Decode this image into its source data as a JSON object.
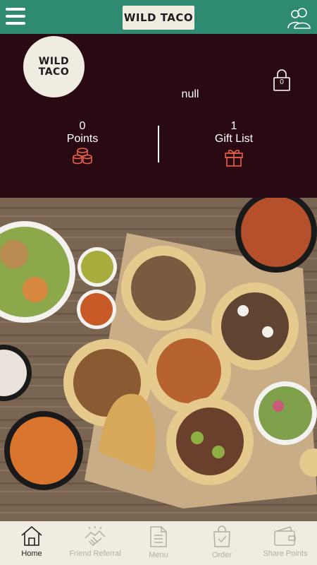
{
  "header": {
    "logo_text": "WILD TACO",
    "menu_icon": "hamburger-menu-icon",
    "profile_icon": "users-icon"
  },
  "account": {
    "logo_line1": "WILD",
    "logo_line2": "TACO",
    "user_name": "null",
    "lock_count": "0",
    "points_value": "0",
    "points_label": "Points",
    "gift_value": "1",
    "gift_label": "Gift List"
  },
  "colors": {
    "header_bg": "#2f8a72",
    "panel_bg": "#2a0a12",
    "accent": "#e8604a",
    "nav_bg": "#f1ece1"
  },
  "nav": {
    "items": [
      {
        "label": "Home",
        "icon": "home-icon",
        "active": true
      },
      {
        "label": "Friend Referral",
        "icon": "handshake-icon",
        "active": false
      },
      {
        "label": "Menu",
        "icon": "document-icon",
        "active": false
      },
      {
        "label": "Order",
        "icon": "shopping-bag-icon",
        "active": false
      },
      {
        "label": "Share Points",
        "icon": "wallet-icon",
        "active": false
      }
    ]
  }
}
